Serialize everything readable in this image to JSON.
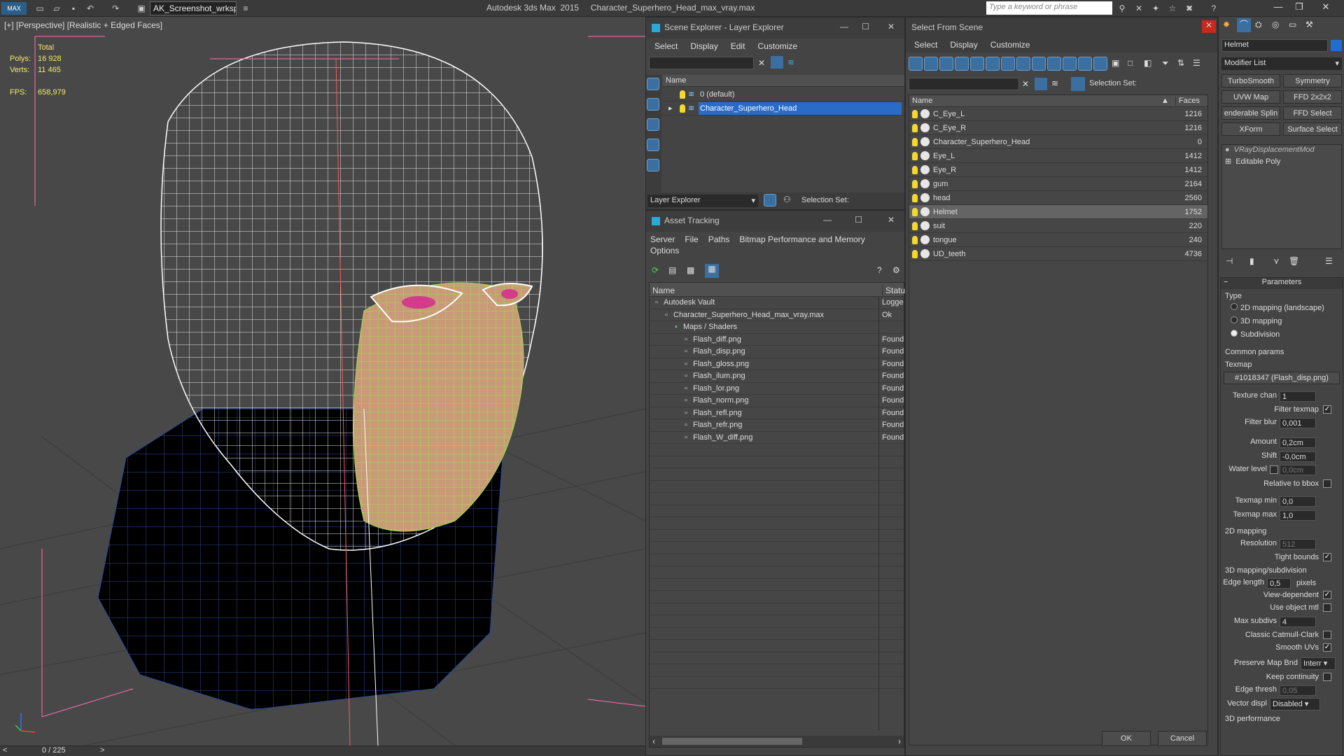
{
  "titlebar": {
    "logo": "MAX",
    "workspace": "AK_Screenshot_wrksp",
    "app_title": "Autodesk 3ds Max  2015     Character_Superhero_Head_max_vray.max",
    "search_placeholder": "Type a keyword or phrase"
  },
  "viewport": {
    "label": "[+] [Perspective] [Realistic + Edged Faces]",
    "stats": {
      "total_label": "Total",
      "polys_label": "Polys:",
      "polys": "16 928",
      "verts_label": "Verts:",
      "verts": "11 465",
      "fps_label": "FPS:",
      "fps": "658,979"
    }
  },
  "scene_explorer": {
    "title": "Scene Explorer - Layer Explorer",
    "menu": [
      "Select",
      "Display",
      "Edit",
      "Customize"
    ],
    "column": "Name",
    "layers": [
      "0 (default)",
      "Character_Superhero_Head"
    ],
    "footer_dropdown": "Layer Explorer",
    "selection_set_label": "Selection Set:"
  },
  "asset_tracking": {
    "title": "Asset Tracking",
    "menu": [
      "Server",
      "File",
      "Paths",
      "Bitmap Performance and Memory",
      "Options"
    ],
    "columns": [
      "Name",
      "Status"
    ],
    "rows": [
      {
        "name": "Autodesk Vault",
        "status": "Logge"
      },
      {
        "name": "Character_Superhero_Head_max_vray.max",
        "status": "Ok"
      },
      {
        "name": "Maps / Shaders",
        "status": ""
      },
      {
        "name": "Flash_diff.png",
        "status": "Found"
      },
      {
        "name": "Flash_disp.png",
        "status": "Found"
      },
      {
        "name": "Flash_gloss.png",
        "status": "Found"
      },
      {
        "name": "Flash_ilum.png",
        "status": "Found"
      },
      {
        "name": "Flash_lor.png",
        "status": "Found"
      },
      {
        "name": "Flash_norm.png",
        "status": "Found"
      },
      {
        "name": "Flash_refl.png",
        "status": "Found"
      },
      {
        "name": "Flash_refr.png",
        "status": "Found"
      },
      {
        "name": "Flash_W_diff.png",
        "status": "Found"
      }
    ]
  },
  "select_from_scene": {
    "title": "Select From Scene",
    "menu": [
      "Select",
      "Display",
      "Customize"
    ],
    "selection_set_label": "Selection Set:",
    "columns": [
      "Name",
      "Faces"
    ],
    "objects": [
      {
        "name": "C_Eye_L",
        "faces": "1216"
      },
      {
        "name": "C_Eye_R",
        "faces": "1216"
      },
      {
        "name": "Character_Superhero_Head",
        "faces": "0"
      },
      {
        "name": "Eye_L",
        "faces": "1412"
      },
      {
        "name": "Eye_R",
        "faces": "1412"
      },
      {
        "name": "gum",
        "faces": "2164"
      },
      {
        "name": "head",
        "faces": "2560"
      },
      {
        "name": "Helmet",
        "faces": "1752"
      },
      {
        "name": "suit",
        "faces": "220"
      },
      {
        "name": "tongue",
        "faces": "240"
      },
      {
        "name": "UD_teeth",
        "faces": "4736"
      }
    ],
    "ok": "OK",
    "cancel": "Cancel"
  },
  "command_panel": {
    "object_name": "Helmet",
    "modifier_list": "Modifier List",
    "modifier_buttons": [
      "TurboSmooth",
      "Symmetry",
      "UVW Map",
      "FFD 2x2x2",
      "enderable Splin",
      "FFD Select",
      "XForm",
      "Surface Select"
    ],
    "stack": [
      "VRayDisplacementMod",
      "Editable Poly"
    ],
    "params_title": "Parameters",
    "type_label": "Type",
    "type_options": [
      "2D mapping (landscape)",
      "3D mapping",
      "Subdivision"
    ],
    "common_params": "Common params",
    "texmap_label": "Texmap",
    "texmap_value": "#1018347 (Flash_disp.png)",
    "texture_chan_label": "Texture chan",
    "texture_chan": "1",
    "filter_texmap": "Filter texmap",
    "filter_blur_label": "Filter blur",
    "filter_blur": "0,001",
    "amount_label": "Amount",
    "amount": "0,2cm",
    "shift_label": "Shift",
    "shift": "-0,0cm",
    "water_level_label": "Water level",
    "water_level": "0,0cm",
    "relative_bbox": "Relative to bbox",
    "texmap_min_label": "Texmap min",
    "texmap_min": "0,0",
    "texmap_max_label": "Texmap max",
    "texmap_max": "1,0",
    "mapping2d": "2D mapping",
    "resolution_label": "Resolution",
    "resolution": "512",
    "tight_bounds": "Tight bounds",
    "mapping3d": "3D mapping/subdivision",
    "edge_length_label": "Edge length",
    "edge_length": "0,5",
    "pixels": "pixels",
    "view_dependent": "View-dependent",
    "use_object_mtl": "Use object mtl",
    "max_subdivs_label": "Max subdivs",
    "max_subdivs": "4",
    "classic_cc": "Classic Catmull-Clark",
    "smooth_uvs": "Smooth UVs",
    "preserve_map_label": "Preserve Map Bnd",
    "preserve_map": "Interr",
    "keep_continuity": "Keep continuity",
    "edge_thresh_label": "Edge thresh",
    "edge_thresh": "0,05",
    "vector_disp_label": "Vector displ",
    "vector_disp": "Disabled",
    "perf_3d": "3D performance"
  },
  "statusbar": {
    "frame": "0 / 225"
  }
}
